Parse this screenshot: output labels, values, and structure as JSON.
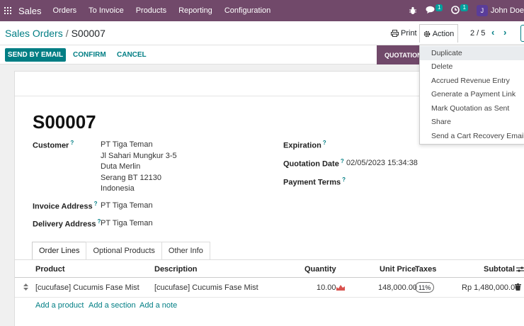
{
  "topbar": {
    "app_name": "Sales",
    "menu": [
      "Orders",
      "To Invoice",
      "Products",
      "Reporting",
      "Configuration"
    ],
    "messages_count": "1",
    "activities_count": "1",
    "user_initial": "J",
    "user_name": "John Doe"
  },
  "control_panel": {
    "breadcrumb_parent": "Sales Orders",
    "breadcrumb_separator": "/",
    "breadcrumb_current": "S00007",
    "print_label": "Print",
    "action_label": "Action",
    "pager": "2 / 5"
  },
  "statusbar": {
    "send_email_label": "SEND BY EMAIL",
    "confirm_label": "CONFIRM",
    "cancel_label": "CANCEL",
    "status_label": "QUOTATION"
  },
  "action_menu": [
    "Duplicate",
    "Delete",
    "Accrued Revenue Entry",
    "Generate a Payment Link",
    "Mark Quotation as Sent",
    "Share",
    "Send a Cart Recovery Email"
  ],
  "form": {
    "name": "S00007",
    "customer_label": "Customer",
    "customer_name": "PT Tiga Teman",
    "customer_address": [
      "Jl Sahari Mungkur 3-5",
      "Duta Merlin",
      "Serang BT 12130",
      "Indonesia"
    ],
    "invoice_address_label": "Invoice Address",
    "invoice_address": "PT Tiga Teman",
    "delivery_address_label": "Delivery Address",
    "delivery_address": "PT Tiga Teman",
    "expiration_label": "Expiration",
    "quotation_date_label": "Quotation Date",
    "quotation_date": "02/05/2023 15:34:38",
    "payment_terms_label": "Payment Terms",
    "help_mark": "?"
  },
  "tabs": [
    "Order Lines",
    "Optional Products",
    "Other Info"
  ],
  "order_lines": {
    "columns": [
      "Product",
      "Description",
      "Quantity",
      "Unit Price",
      "Taxes",
      "Subtotal"
    ],
    "rows": [
      {
        "product": "[cucufase] Cucumis Fase Mist",
        "description": "[cucufase] Cucumis Fase Mist",
        "quantity": "10.00",
        "unit_price": "148,000.00",
        "taxes": "11%",
        "subtotal": "Rp 1,480,000.00"
      }
    ],
    "add_product": "Add a product",
    "add_section": "Add a section",
    "add_note": "Add a note"
  },
  "colors": {
    "brand": "#71496a",
    "accent": "#017e84"
  }
}
